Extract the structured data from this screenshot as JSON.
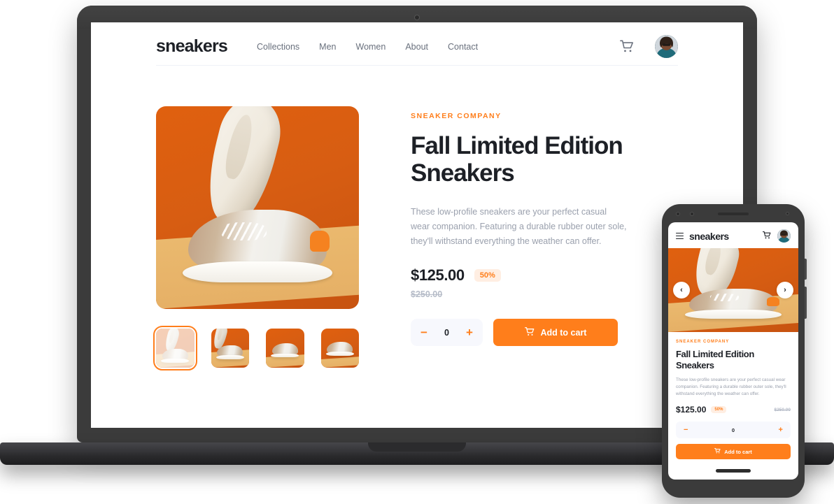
{
  "desktop": {
    "brand": "sneakers",
    "nav_links": [
      "Collections",
      "Men",
      "Women",
      "About",
      "Contact"
    ],
    "cart_icon": "cart-icon",
    "avatar_icon": "user-avatar",
    "product": {
      "eyebrow": "SNEAKER COMPANY",
      "title": "Fall Limited Edition Sneakers",
      "description": "These low-profile sneakers are your perfect casual wear companion. Featuring a durable rubber outer sole, they'll withstand everything the weather can offer.",
      "price": "$125.00",
      "discount": "50%",
      "old_price": "$250.00",
      "quantity": "0",
      "minus_label": "−",
      "plus_label": "+",
      "add_to_cart_label": "Add to cart",
      "thumbnail_count": 4,
      "selected_thumbnail": 1
    }
  },
  "mobile": {
    "brand": "sneakers",
    "menu_icon": "hamburger-menu-icon",
    "cart_icon": "cart-icon",
    "avatar_icon": "user-avatar",
    "carousel": {
      "prev_label": "‹",
      "next_label": "›"
    },
    "product": {
      "eyebrow": "SNEAKER COMPANY",
      "title": "Fall Limited Edition Sneakers",
      "description": "These low-profile sneakers are your perfect casual wear companion. Featuring a durable rubber outer sole, they'll withstand everything the weather can offer.",
      "price": "$125.00",
      "discount": "50%",
      "old_price": "$250.00",
      "quantity": "0",
      "minus_label": "−",
      "plus_label": "+",
      "add_to_cart_label": "Add to cart"
    }
  },
  "colors": {
    "accent": "#ff7e1b",
    "accent_pale": "#ffeee2",
    "text_dark": "#1d2026",
    "text_muted": "#9aa0ad",
    "stepper_bg": "#f7f8fd",
    "device_frame": "#3b3b3b"
  }
}
